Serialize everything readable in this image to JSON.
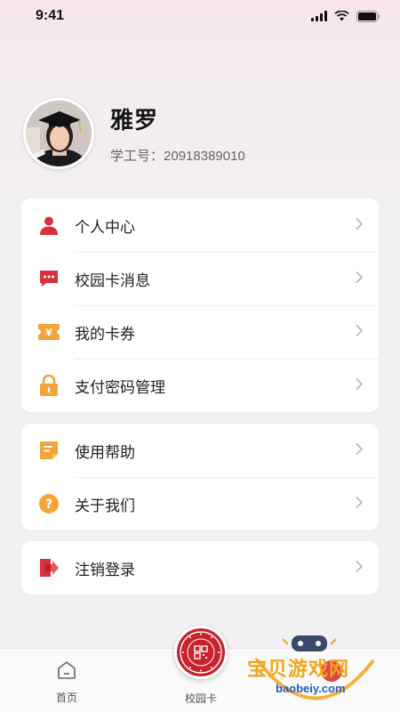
{
  "status_bar": {
    "time": "9:41"
  },
  "profile": {
    "name": "雅罗",
    "id_label": "学工号：",
    "id_value": "20918389010"
  },
  "menu_group_1": [
    {
      "label": "个人中心",
      "icon": "person-icon",
      "color": "#d7323c"
    },
    {
      "label": "校园卡消息",
      "icon": "message-icon",
      "color": "#d7323c"
    },
    {
      "label": "我的卡券",
      "icon": "coupon-icon",
      "color": "#f2a53a"
    },
    {
      "label": "支付密码管理",
      "icon": "lock-icon",
      "color": "#f2a53a"
    }
  ],
  "menu_group_2": [
    {
      "label": "使用帮助",
      "icon": "help-doc-icon",
      "color": "#f2a53a"
    },
    {
      "label": "关于我们",
      "icon": "question-icon",
      "color": "#f2a53a"
    }
  ],
  "menu_group_3": [
    {
      "label": "注销登录",
      "icon": "logout-icon",
      "color": "#d7323c"
    }
  ],
  "tabbar": {
    "home_label": "首页",
    "card_label": "校园卡"
  },
  "watermark": {
    "text": "宝贝游戏网",
    "url": "baobeiy.com"
  },
  "colors": {
    "accent": "#c8232c",
    "secondary": "#f2a53a"
  }
}
